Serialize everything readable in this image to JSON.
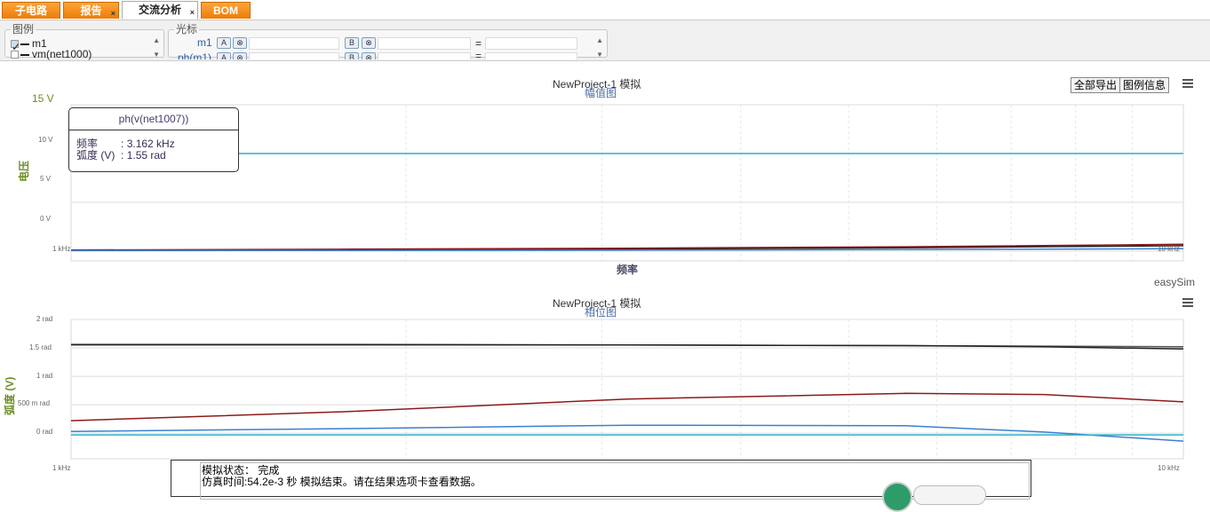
{
  "tabs": [
    {
      "label": "子电路",
      "closable": false,
      "active": false
    },
    {
      "label": "报告",
      "closable": true,
      "active": false
    },
    {
      "label": "交流分析",
      "closable": true,
      "active": true
    },
    {
      "label": "BOM",
      "closable": false,
      "active": false
    }
  ],
  "legend_panel": {
    "title": "图例",
    "items": [
      {
        "label": "m1",
        "checked": true
      },
      {
        "label": "vm(net1000)",
        "checked": false
      }
    ]
  },
  "cursor_panel": {
    "title": "光标",
    "rows": [
      {
        "label": "m1",
        "a": "A",
        "b": "B",
        "eq": "="
      },
      {
        "label": "ph(m1)",
        "a": "A",
        "b": "B",
        "eq": "="
      }
    ]
  },
  "buttons": {
    "export_all": "全部导出",
    "legend_info": "图例信息"
  },
  "watermark": "easySim",
  "tooltip": {
    "title": "ph(v(net1007))",
    "rows": [
      {
        "key": "频率",
        "sep": ":",
        "value": "3.162 kHz"
      },
      {
        "key": "弧度 (V)",
        "sep": ":",
        "value": "1.55 rad"
      }
    ]
  },
  "status": {
    "line1": "模拟状态：  完成",
    "line2": "仿真时间:54.2e-3 秒 模拟结束。请在结果选项卡查看数据。"
  },
  "colors": {
    "cyan": "#2ab0c9",
    "blue": "#3a7fd0",
    "dark_red": "#8b1a1a",
    "black": "#222222",
    "gray": "#555555",
    "axis_green": "#6b8e23"
  },
  "chart_data": [
    {
      "type": "line",
      "title": "NewProject-1 模拟",
      "subtitle": "幅值图",
      "xlabel": "频率",
      "ylabel": "电压",
      "x_scale": "log",
      "xlim": [
        1000,
        10000
      ],
      "x_tick_labels": [
        "1 kHz",
        "10 kHz"
      ],
      "ylim": [
        -1,
        15
      ],
      "y_tick_labels": [
        "0 V",
        "5 V",
        "10 V",
        "15 V"
      ],
      "grid": true,
      "x": [
        1000,
        1778,
        3162,
        5623,
        10000
      ],
      "series": [
        {
          "color": "#2ab0c9",
          "values": [
            10,
            10,
            10,
            10,
            10
          ]
        },
        {
          "color": "#222222",
          "values": [
            0.1,
            0.13,
            0.2,
            0.35,
            0.55
          ]
        },
        {
          "color": "#8b1a1a",
          "values": [
            0.12,
            0.2,
            0.3,
            0.45,
            0.7
          ]
        },
        {
          "color": "#3a7fd0",
          "values": [
            0.05,
            0.07,
            0.1,
            0.15,
            0.25
          ]
        }
      ]
    },
    {
      "type": "line",
      "title": "NewProject-1 模拟",
      "subtitle": "相位图",
      "xlabel": "频率",
      "ylabel": "弧度 (V)",
      "x_scale": "log",
      "xlim": [
        1000,
        10000
      ],
      "x_tick_labels": [
        "1 kHz",
        "10 kHz"
      ],
      "ylim": [
        -0.45,
        2
      ],
      "y_tick_labels": [
        "0 rad",
        "500 m rad",
        "1 rad",
        "1.5 rad",
        "2 rad"
      ],
      "grid": true,
      "x": [
        1000,
        1778,
        3162,
        5623,
        7499,
        10000
      ],
      "series": [
        {
          "color": "#555555",
          "values": [
            1.55,
            1.55,
            1.55,
            1.54,
            1.53,
            1.52
          ]
        },
        {
          "color": "#222222",
          "values": [
            1.56,
            1.56,
            1.55,
            1.54,
            1.52,
            1.48
          ]
        },
        {
          "color": "#8b1a1a",
          "values": [
            0.22,
            0.38,
            0.6,
            0.7,
            0.68,
            0.55
          ]
        },
        {
          "color": "#3a7fd0",
          "values": [
            0.03,
            0.08,
            0.14,
            0.13,
            0.02,
            -0.14
          ]
        },
        {
          "color": "#2ab0c9",
          "values": [
            -0.03,
            -0.03,
            -0.03,
            -0.03,
            -0.03,
            -0.03
          ]
        }
      ]
    }
  ]
}
